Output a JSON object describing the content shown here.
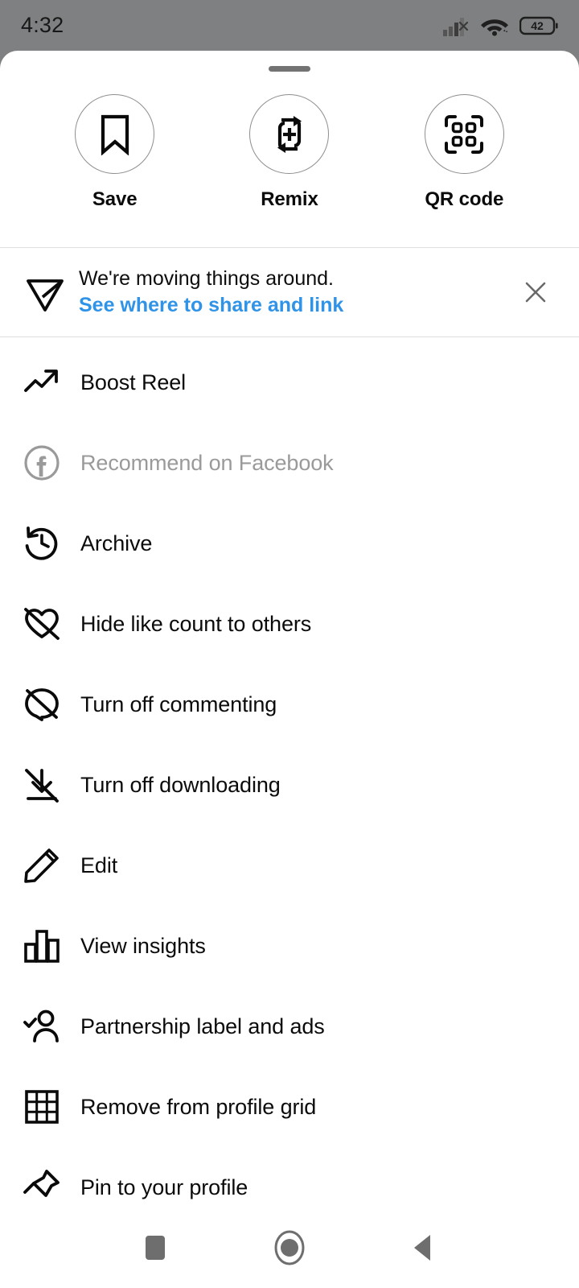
{
  "status_bar": {
    "time": "4:32",
    "battery_level": "42",
    "icons": [
      "cellular-signal-no-sim-icon",
      "wifi-icon",
      "battery-icon"
    ],
    "background_color": "#7f8081"
  },
  "sheet": {
    "handle": "drag-handle",
    "background_color": "#ffffff"
  },
  "actions": [
    {
      "label": "Save",
      "icon": "bookmark-icon"
    },
    {
      "label": "Remix",
      "icon": "remix-loop-plus-icon"
    },
    {
      "label": "QR code",
      "icon": "qr-code-icon"
    }
  ],
  "banner": {
    "icon": "share-paper-plane-icon",
    "title": "We're moving things around.",
    "link": "See where to share and link",
    "link_color": "#2f93e8",
    "close_icon": "close-icon"
  },
  "menu": {
    "items": [
      {
        "label": "Boost Reel",
        "icon": "trending-up-icon",
        "disabled": false
      },
      {
        "label": "Recommend on Facebook",
        "icon": "facebook-icon",
        "disabled": true
      },
      {
        "label": "Archive",
        "icon": "archive-clock-icon",
        "disabled": false
      },
      {
        "label": "Hide like count to others",
        "icon": "heart-off-icon",
        "disabled": false
      },
      {
        "label": "Turn off commenting",
        "icon": "comment-off-icon",
        "disabled": false
      },
      {
        "label": "Turn off downloading",
        "icon": "download-off-icon",
        "disabled": false
      },
      {
        "label": "Edit",
        "icon": "pencil-icon",
        "disabled": false
      },
      {
        "label": "View insights",
        "icon": "bar-chart-icon",
        "disabled": false
      },
      {
        "label": "Partnership label and ads",
        "icon": "person-check-icon",
        "disabled": false
      },
      {
        "label": "Remove from profile grid",
        "icon": "grid-icon",
        "disabled": false
      },
      {
        "label": "Pin to your profile",
        "icon": "pushpin-icon",
        "disabled": false
      }
    ]
  },
  "nav_bar": {
    "buttons": [
      {
        "name": "recents",
        "icon": "square-icon"
      },
      {
        "name": "home",
        "icon": "circle-icon"
      },
      {
        "name": "back",
        "icon": "triangle-back-icon"
      }
    ]
  }
}
